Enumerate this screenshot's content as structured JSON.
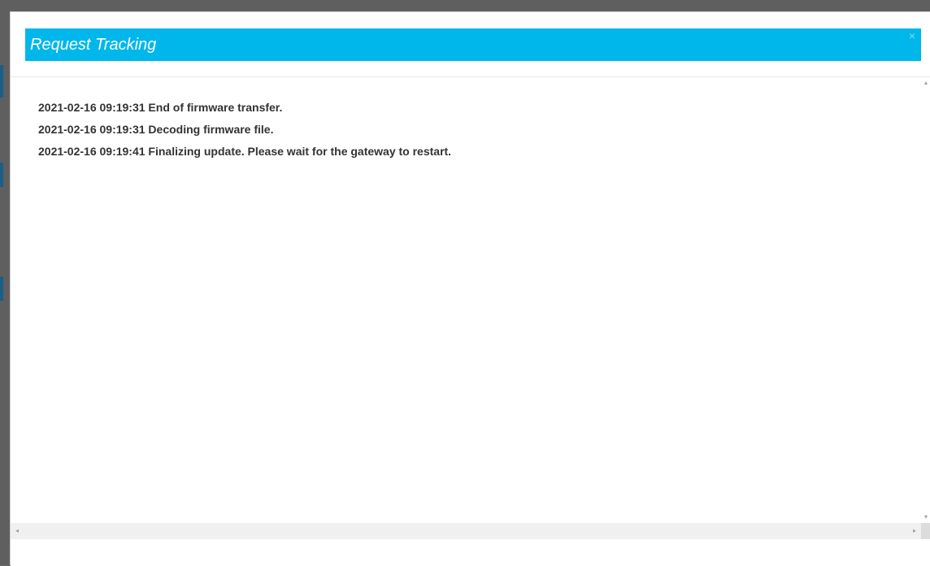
{
  "dialog": {
    "title": "Request Tracking",
    "close_glyph": "×"
  },
  "log": {
    "lines": [
      "2021-02-16 09:19:31 End of firmware transfer.",
      "2021-02-16 09:19:31 Decoding firmware file.",
      "2021-02-16 09:19:41 Finalizing update. Please wait for the gateway to restart."
    ]
  },
  "scrollbars": {
    "up_glyph": "▴",
    "down_glyph": "▾",
    "left_glyph": "◂",
    "right_glyph": "▸"
  },
  "colors": {
    "title_bar": "#00b7eb",
    "title_text": "#ffffff",
    "log_text": "#333333"
  }
}
